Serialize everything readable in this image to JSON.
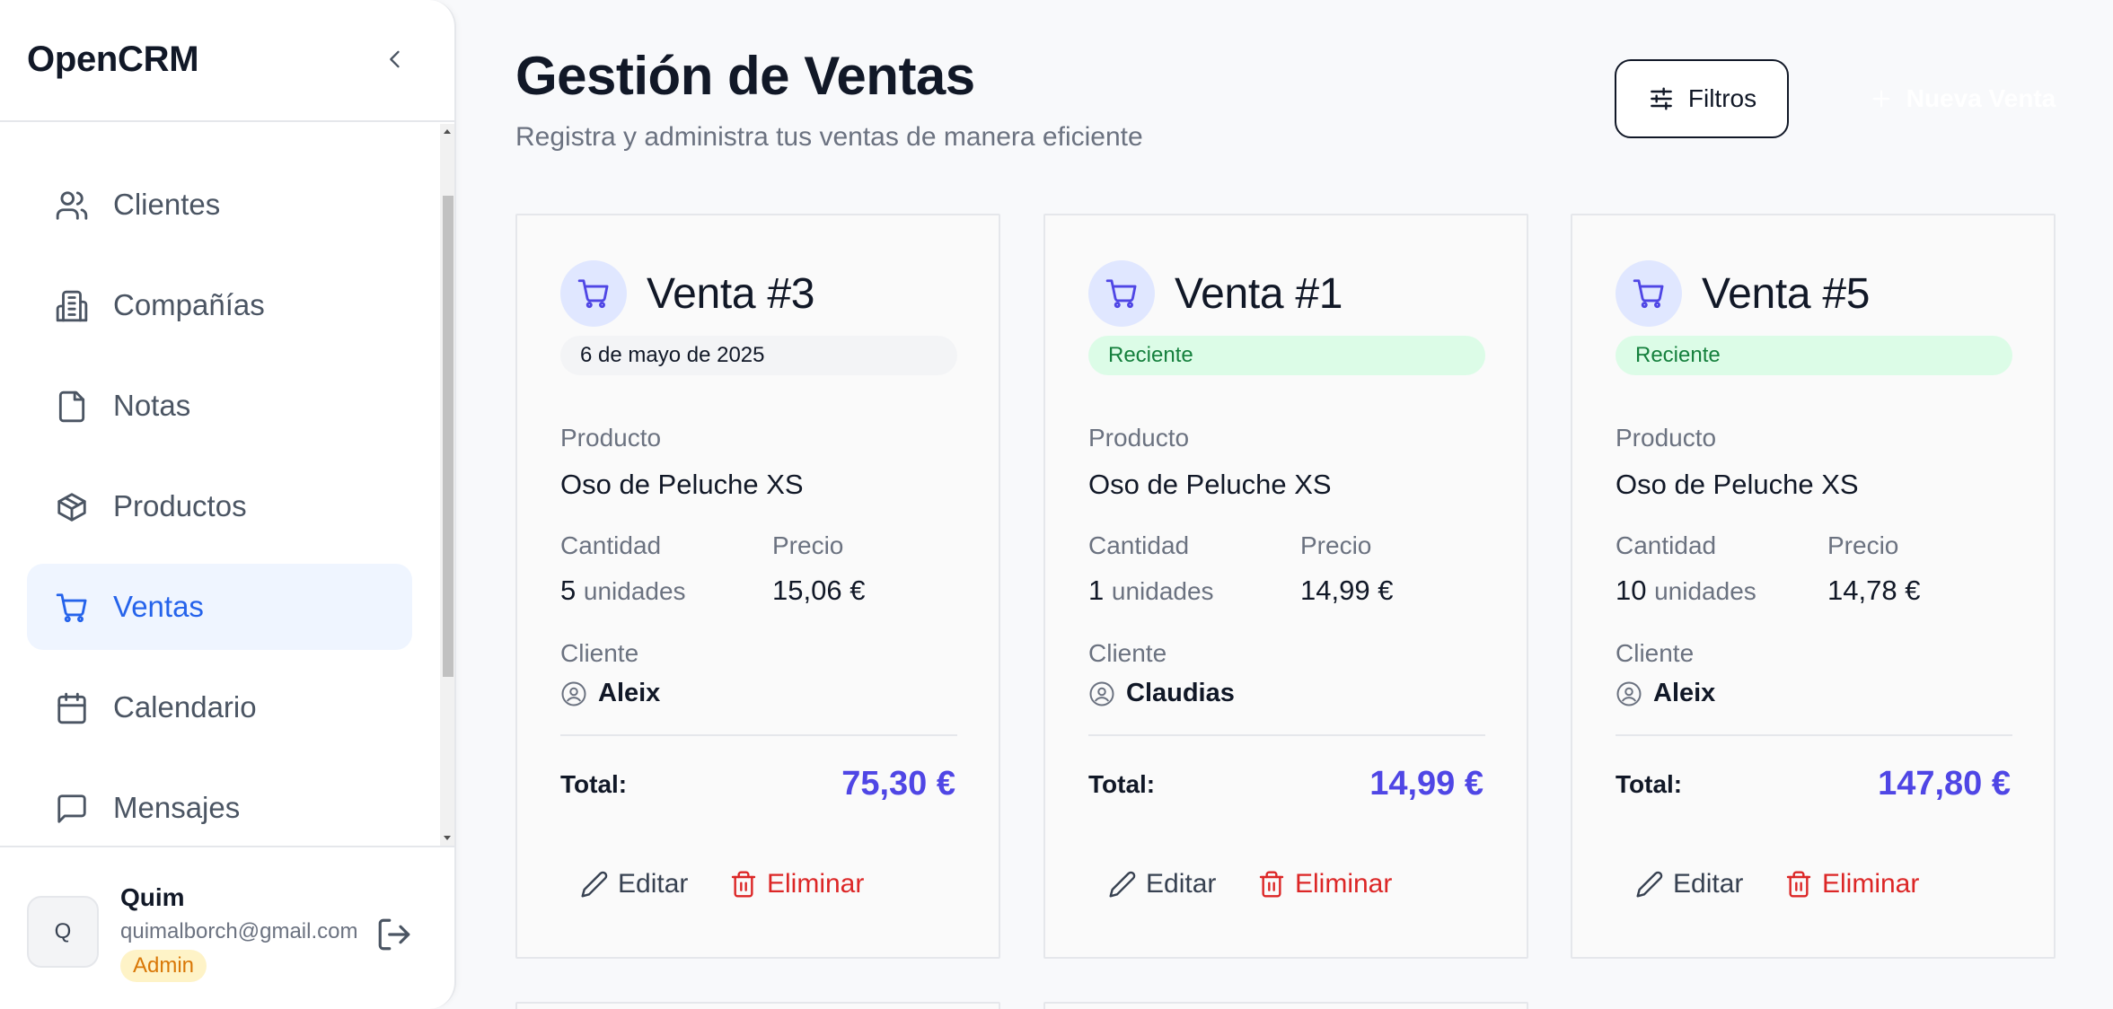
{
  "sidebar": {
    "brand": "OpenCRM",
    "items": [
      {
        "label": "Clientes",
        "icon": "users-icon"
      },
      {
        "label": "Compañías",
        "icon": "building-icon"
      },
      {
        "label": "Notas",
        "icon": "note-icon"
      },
      {
        "label": "Productos",
        "icon": "package-icon"
      },
      {
        "label": "Ventas",
        "icon": "cart-icon",
        "active": true
      },
      {
        "label": "Calendario",
        "icon": "calendar-icon"
      },
      {
        "label": "Mensajes",
        "icon": "message-icon"
      }
    ],
    "user": {
      "initial": "Q",
      "name": "Quim",
      "email": "quimalborch@gmail.com",
      "role": "Admin"
    }
  },
  "header": {
    "title": "Gestión de Ventas",
    "subtitle": "Registra y administra tus ventas de manera eficiente",
    "filter_label": "Filtros",
    "new_label": "Nueva Venta"
  },
  "labels": {
    "product": "Producto",
    "quantity": "Cantidad",
    "price": "Precio",
    "client": "Cliente",
    "total": "Total:",
    "units": "unidades",
    "edit": "Editar",
    "delete": "Eliminar"
  },
  "sales": [
    {
      "title": "Venta #3",
      "badge": "6 de mayo de 2025",
      "badge_type": "date",
      "product": "Oso de Peluche XS",
      "quantity": "5",
      "price": "15,06 €",
      "client": "Aleix",
      "total": "75,30 €"
    },
    {
      "title": "Venta #1",
      "badge": "Reciente",
      "badge_type": "recent",
      "product": "Oso de Peluche XS",
      "quantity": "1",
      "price": "14,99 €",
      "client": "Claudias",
      "total": "14,99 €"
    },
    {
      "title": "Venta #5",
      "badge": "Reciente",
      "badge_type": "recent",
      "product": "Oso de Peluche XS",
      "quantity": "10",
      "price": "14,78 €",
      "client": "Aleix",
      "total": "147,80 €"
    }
  ],
  "colors": {
    "accent": "#2563eb",
    "total": "#4f46e5",
    "danger": "#dc2626",
    "recent_bg": "#dcfce7",
    "recent_text": "#15803d",
    "admin_bg": "#fef3c7",
    "admin_text": "#d97706"
  }
}
